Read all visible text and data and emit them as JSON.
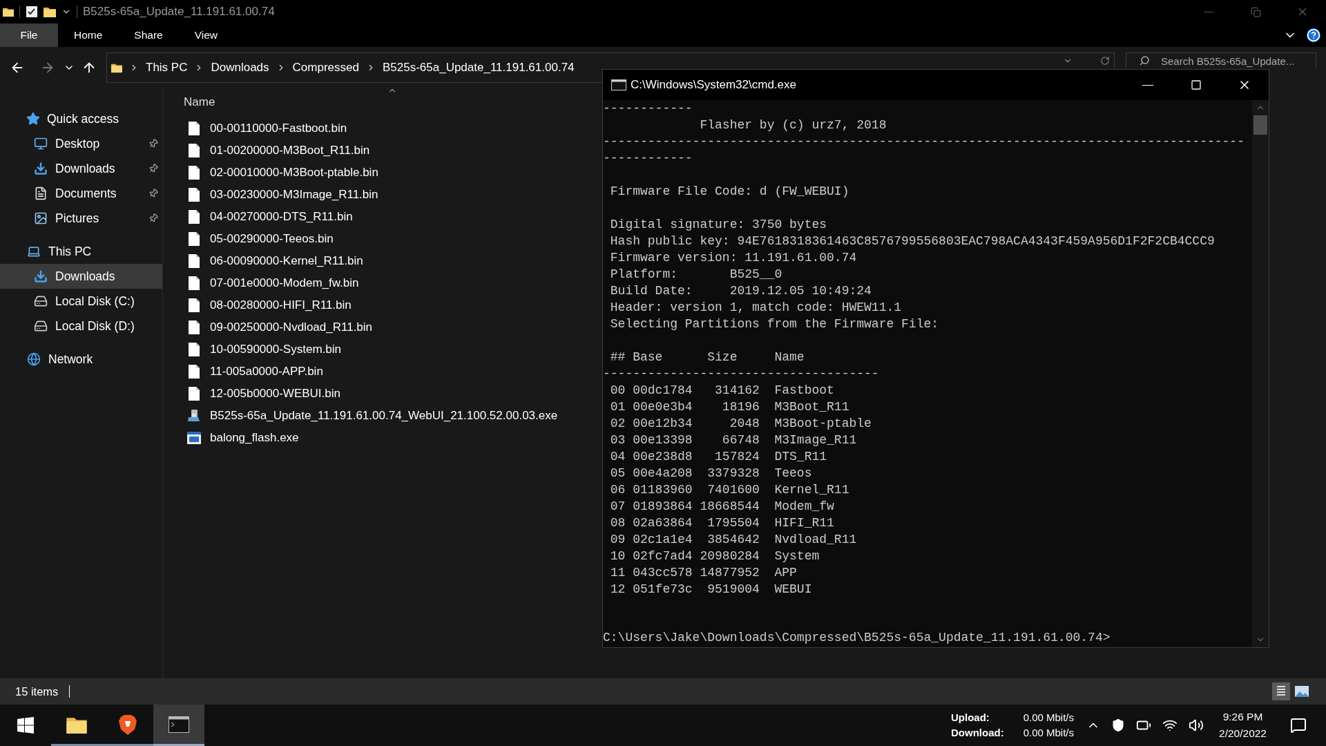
{
  "explorer": {
    "title": "B525s-65a_Update_11.191.61.00.74",
    "ribbon_tabs": [
      {
        "label": "File",
        "selected": true
      },
      {
        "label": "Home",
        "selected": false
      },
      {
        "label": "Share",
        "selected": false
      },
      {
        "label": "View",
        "selected": false
      }
    ],
    "breadcrumbs": [
      "This PC",
      "Downloads",
      "Compressed",
      "B525s-65a_Update_11.191.61.00.74"
    ],
    "search": {
      "placeholder": "Search B525s-65a_Update..."
    },
    "sidebar": [
      {
        "label": "Quick access",
        "kind": "star",
        "selected": false,
        "children": [
          {
            "label": "Desktop",
            "kind": "desktop",
            "pinned": true,
            "selected": false
          },
          {
            "label": "Downloads",
            "kind": "download",
            "pinned": true,
            "selected": false
          },
          {
            "label": "Documents",
            "kind": "document",
            "pinned": true,
            "selected": false
          },
          {
            "label": "Pictures",
            "kind": "pictures",
            "pinned": true,
            "selected": false
          }
        ]
      },
      {
        "label": "This PC",
        "kind": "pc",
        "selected": false,
        "children": [
          {
            "label": "Downloads",
            "kind": "download",
            "pinned": false,
            "selected": true
          },
          {
            "label": "Local Disk (C:)",
            "kind": "disk",
            "pinned": false,
            "selected": false
          },
          {
            "label": "Local Disk (D:)",
            "kind": "disk",
            "pinned": false,
            "selected": false
          }
        ]
      },
      {
        "label": "Network",
        "kind": "network",
        "selected": false
      }
    ],
    "column": "Name",
    "files": [
      {
        "name": "00-00110000-Fastboot.bin",
        "kind": "file"
      },
      {
        "name": "01-00200000-M3Boot_R11.bin",
        "kind": "file"
      },
      {
        "name": "02-00010000-M3Boot-ptable.bin",
        "kind": "file"
      },
      {
        "name": "03-00230000-M3Image_R11.bin",
        "kind": "file"
      },
      {
        "name": "04-00270000-DTS_R11.bin",
        "kind": "file"
      },
      {
        "name": "05-00290000-Teeos.bin",
        "kind": "file"
      },
      {
        "name": "06-00090000-Kernel_R11.bin",
        "kind": "file"
      },
      {
        "name": "07-001e0000-Modem_fw.bin",
        "kind": "file"
      },
      {
        "name": "08-00280000-HIFI_R11.bin",
        "kind": "file"
      },
      {
        "name": "09-00250000-Nvdload_R11.bin",
        "kind": "file"
      },
      {
        "name": "10-00590000-System.bin",
        "kind": "file"
      },
      {
        "name": "11-005a0000-APP.bin",
        "kind": "file"
      },
      {
        "name": "12-005b0000-WEBUI.bin",
        "kind": "file"
      },
      {
        "name": "B525s-65a_Update_11.191.61.00.74_WebUI_21.100.52.00.03.exe",
        "kind": "installer"
      },
      {
        "name": "balong_flash.exe",
        "kind": "app"
      }
    ],
    "status": "15 items",
    "views": [
      {
        "kind": "details",
        "selected": true
      },
      {
        "kind": "large",
        "selected": false
      }
    ]
  },
  "console": {
    "title": "C:\\Windows\\System32\\cmd.exe",
    "blocks": [
      [
        "------------",
        "             Flasher by (c) urz7, 2018",
        "--------------------------------------------------------------------------------------",
        "------------"
      ],
      [
        " Firmware File Code: d (FW_WEBUI)"
      ],
      [
        " Digital signature: 3750 bytes",
        " Hash public key: 94E7618318361463C8576799556803EAC798ACA4343F459A956D1F2F2CB4CCC9",
        " Firmware version: 11.191.61.00.74",
        " Platform:       B525__0",
        " Build Date:     2019.12.05 10:49:24",
        " Header: version 1, match code: HWEW11.1",
        " Selecting Partitions from the Firmware File:"
      ],
      [
        " ## Base      Size     Name",
        "-------------------------------------",
        " 00 00dc1784   314162  Fastboot",
        " 01 00e0e3b4    18196  M3Boot_R11",
        " 02 00e12b34     2048  M3Boot-ptable",
        " 03 00e13398    66748  M3Image_R11",
        " 04 00e238d8   157824  DTS_R11",
        " 05 00e4a208  3379328  Teeos",
        " 06 01183960  7401600  Kernel_R11",
        " 07 01893864 18668544  Modem_fw",
        " 08 02a63864  1795504  HIFI_R11",
        " 09 02c1a1e4  3854642  Nvdload_R11",
        " 10 02fc7ad4 20980284  System",
        " 11 043cc578 14877952  APP",
        " 12 051fe73c  9519004  WEBUI"
      ]
    ],
    "prompt": "C:\\Users\\Jake\\Downloads\\Compressed\\B525s-65a_Update_11.191.61.00.74>"
  },
  "taskbar": {
    "apps": [
      {
        "kind": "explorer",
        "active": false
      },
      {
        "kind": "browser",
        "active": false
      },
      {
        "kind": "terminal",
        "active": true
      }
    ],
    "upload_label": "Upload:",
    "upload_value": "0.00 Mbit/s",
    "download_label": "Download:",
    "download_value": "0.00 Mbit/s",
    "time": "9:26 PM",
    "date": "2/20/2022"
  }
}
